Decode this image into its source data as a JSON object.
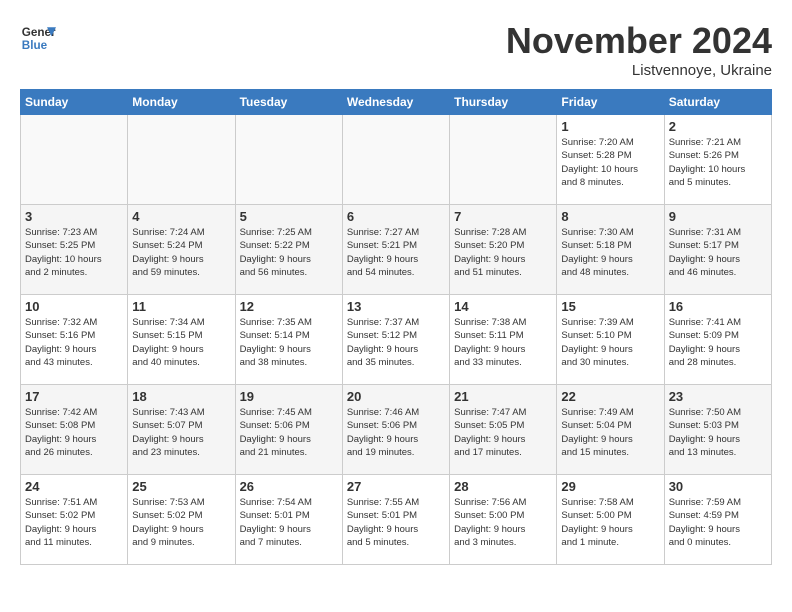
{
  "header": {
    "logo_line1": "General",
    "logo_line2": "Blue",
    "month_title": "November 2024",
    "location": "Listvennoye, Ukraine"
  },
  "weekdays": [
    "Sunday",
    "Monday",
    "Tuesday",
    "Wednesday",
    "Thursday",
    "Friday",
    "Saturday"
  ],
  "weeks": [
    [
      {
        "day": "",
        "info": ""
      },
      {
        "day": "",
        "info": ""
      },
      {
        "day": "",
        "info": ""
      },
      {
        "day": "",
        "info": ""
      },
      {
        "day": "",
        "info": ""
      },
      {
        "day": "1",
        "info": "Sunrise: 7:20 AM\nSunset: 5:28 PM\nDaylight: 10 hours\nand 8 minutes."
      },
      {
        "day": "2",
        "info": "Sunrise: 7:21 AM\nSunset: 5:26 PM\nDaylight: 10 hours\nand 5 minutes."
      }
    ],
    [
      {
        "day": "3",
        "info": "Sunrise: 7:23 AM\nSunset: 5:25 PM\nDaylight: 10 hours\nand 2 minutes."
      },
      {
        "day": "4",
        "info": "Sunrise: 7:24 AM\nSunset: 5:24 PM\nDaylight: 9 hours\nand 59 minutes."
      },
      {
        "day": "5",
        "info": "Sunrise: 7:25 AM\nSunset: 5:22 PM\nDaylight: 9 hours\nand 56 minutes."
      },
      {
        "day": "6",
        "info": "Sunrise: 7:27 AM\nSunset: 5:21 PM\nDaylight: 9 hours\nand 54 minutes."
      },
      {
        "day": "7",
        "info": "Sunrise: 7:28 AM\nSunset: 5:20 PM\nDaylight: 9 hours\nand 51 minutes."
      },
      {
        "day": "8",
        "info": "Sunrise: 7:30 AM\nSunset: 5:18 PM\nDaylight: 9 hours\nand 48 minutes."
      },
      {
        "day": "9",
        "info": "Sunrise: 7:31 AM\nSunset: 5:17 PM\nDaylight: 9 hours\nand 46 minutes."
      }
    ],
    [
      {
        "day": "10",
        "info": "Sunrise: 7:32 AM\nSunset: 5:16 PM\nDaylight: 9 hours\nand 43 minutes."
      },
      {
        "day": "11",
        "info": "Sunrise: 7:34 AM\nSunset: 5:15 PM\nDaylight: 9 hours\nand 40 minutes."
      },
      {
        "day": "12",
        "info": "Sunrise: 7:35 AM\nSunset: 5:14 PM\nDaylight: 9 hours\nand 38 minutes."
      },
      {
        "day": "13",
        "info": "Sunrise: 7:37 AM\nSunset: 5:12 PM\nDaylight: 9 hours\nand 35 minutes."
      },
      {
        "day": "14",
        "info": "Sunrise: 7:38 AM\nSunset: 5:11 PM\nDaylight: 9 hours\nand 33 minutes."
      },
      {
        "day": "15",
        "info": "Sunrise: 7:39 AM\nSunset: 5:10 PM\nDaylight: 9 hours\nand 30 minutes."
      },
      {
        "day": "16",
        "info": "Sunrise: 7:41 AM\nSunset: 5:09 PM\nDaylight: 9 hours\nand 28 minutes."
      }
    ],
    [
      {
        "day": "17",
        "info": "Sunrise: 7:42 AM\nSunset: 5:08 PM\nDaylight: 9 hours\nand 26 minutes."
      },
      {
        "day": "18",
        "info": "Sunrise: 7:43 AM\nSunset: 5:07 PM\nDaylight: 9 hours\nand 23 minutes."
      },
      {
        "day": "19",
        "info": "Sunrise: 7:45 AM\nSunset: 5:06 PM\nDaylight: 9 hours\nand 21 minutes."
      },
      {
        "day": "20",
        "info": "Sunrise: 7:46 AM\nSunset: 5:06 PM\nDaylight: 9 hours\nand 19 minutes."
      },
      {
        "day": "21",
        "info": "Sunrise: 7:47 AM\nSunset: 5:05 PM\nDaylight: 9 hours\nand 17 minutes."
      },
      {
        "day": "22",
        "info": "Sunrise: 7:49 AM\nSunset: 5:04 PM\nDaylight: 9 hours\nand 15 minutes."
      },
      {
        "day": "23",
        "info": "Sunrise: 7:50 AM\nSunset: 5:03 PM\nDaylight: 9 hours\nand 13 minutes."
      }
    ],
    [
      {
        "day": "24",
        "info": "Sunrise: 7:51 AM\nSunset: 5:02 PM\nDaylight: 9 hours\nand 11 minutes."
      },
      {
        "day": "25",
        "info": "Sunrise: 7:53 AM\nSunset: 5:02 PM\nDaylight: 9 hours\nand 9 minutes."
      },
      {
        "day": "26",
        "info": "Sunrise: 7:54 AM\nSunset: 5:01 PM\nDaylight: 9 hours\nand 7 minutes."
      },
      {
        "day": "27",
        "info": "Sunrise: 7:55 AM\nSunset: 5:01 PM\nDaylight: 9 hours\nand 5 minutes."
      },
      {
        "day": "28",
        "info": "Sunrise: 7:56 AM\nSunset: 5:00 PM\nDaylight: 9 hours\nand 3 minutes."
      },
      {
        "day": "29",
        "info": "Sunrise: 7:58 AM\nSunset: 5:00 PM\nDaylight: 9 hours\nand 1 minute."
      },
      {
        "day": "30",
        "info": "Sunrise: 7:59 AM\nSunset: 4:59 PM\nDaylight: 9 hours\nand 0 minutes."
      }
    ]
  ]
}
